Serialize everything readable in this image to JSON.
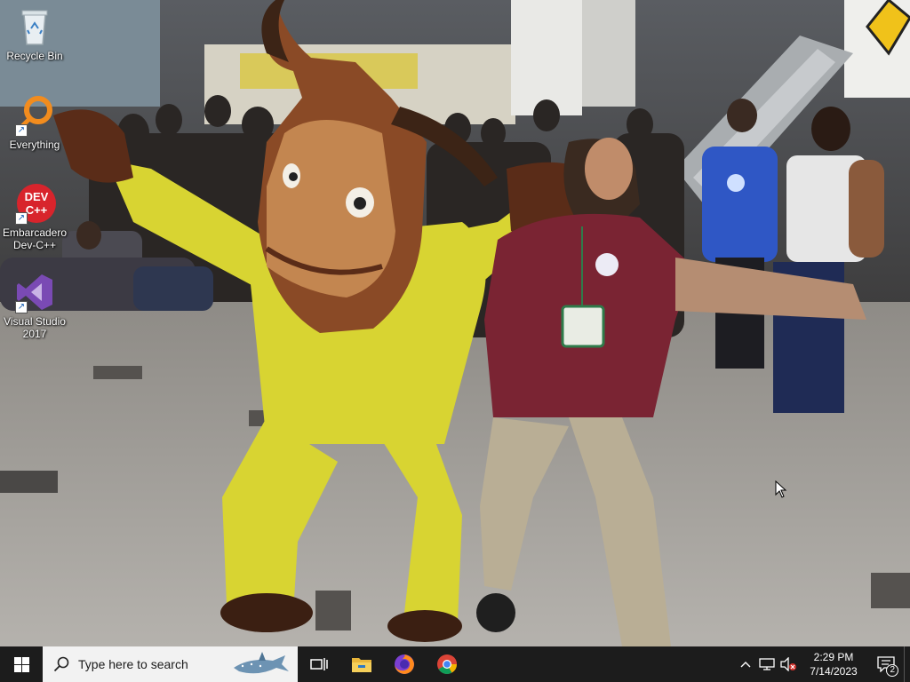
{
  "desktop": {
    "icons": [
      {
        "label": "Recycle Bin",
        "icon": "recycle-bin-icon"
      },
      {
        "label": "Everything",
        "icon": "everything-search-icon"
      },
      {
        "label": "Embarcadero Dev-C++",
        "icon": "devcpp-icon",
        "badge": "DEV C++"
      },
      {
        "label": "Visual Studio 2017",
        "icon": "visual-studio-icon"
      }
    ]
  },
  "taskbar": {
    "search_placeholder": "Type here to search",
    "pinned": [
      {
        "name": "task-view",
        "icon": "task-view-icon"
      },
      {
        "name": "file-explorer",
        "icon": "folder-icon"
      },
      {
        "name": "firefox",
        "icon": "firefox-icon"
      },
      {
        "name": "chrome",
        "icon": "chrome-icon"
      }
    ],
    "tray": {
      "time": "2:29 PM",
      "date": "7/14/2023",
      "notification_count": "2"
    }
  },
  "colors": {
    "taskbar": "#1c1c1c",
    "accent_windows": "#ffffff",
    "costume_yellow": "#d8d432",
    "shirt_maroon": "#7a2433"
  }
}
